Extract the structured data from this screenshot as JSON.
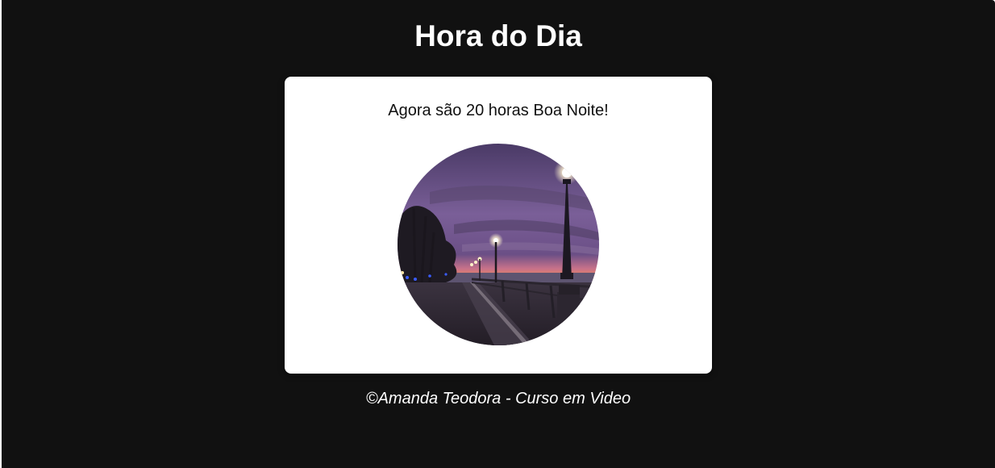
{
  "header": {
    "title": "Hora do Dia"
  },
  "card": {
    "message": "Agora são 20 horas Boa Noite!",
    "image_subject": "night-promenade-with-street-lamps"
  },
  "footer": {
    "text": "©Amanda Teodora - Curso em Video"
  },
  "colors": {
    "background": "#111111",
    "card": "#ffffff",
    "text_light": "#ffffff",
    "text_dark": "#111111"
  }
}
